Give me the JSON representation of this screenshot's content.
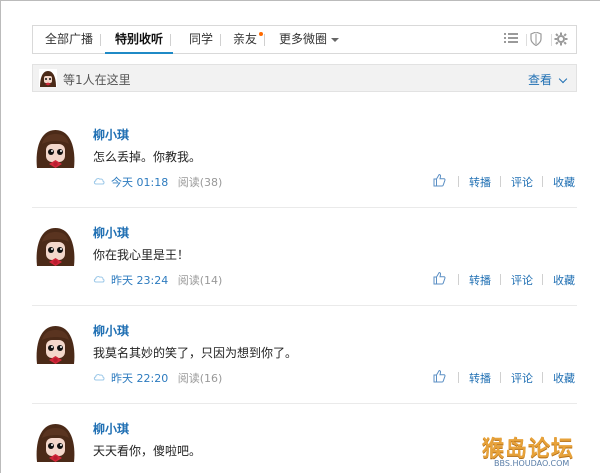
{
  "tabs": [
    {
      "label": "全部广播"
    },
    {
      "label": "特别收听"
    },
    {
      "label": "同学"
    },
    {
      "label": "亲友"
    },
    {
      "label": "更多微圈"
    }
  ],
  "herebar": {
    "text": "等1人在这里",
    "view": "查看"
  },
  "feed": {
    "items": [
      {
        "name": "柳小琪",
        "text": "怎么丢掉。你教我。",
        "time": "今天 01:18",
        "reads": "阅读(38)"
      },
      {
        "name": "柳小琪",
        "text": "你在我心里是王！",
        "time": "昨天 23:24",
        "reads": "阅读(14)"
      },
      {
        "name": "柳小琪",
        "text": "我莫名其妙的笑了，只因为想到你了。",
        "time": "昨天 22:20",
        "reads": "阅读(16)"
      },
      {
        "name": "柳小琪",
        "text": "天天看你，傻啦吧。",
        "time": "",
        "reads": ""
      }
    ],
    "actions": {
      "repost": "转播",
      "comment": "评论",
      "fav": "收藏"
    }
  },
  "watermark": {
    "big": "猴岛论坛",
    "small": "BBS.HOUDAO.COM"
  },
  "icons": {
    "list": "list-icon",
    "shield": "shield-icon",
    "gear": "gear-icon",
    "like": "like-icon",
    "cloud": "cloud-icon"
  },
  "colors": {
    "accent": "#1f8ac6",
    "link": "#1f6fb3",
    "dot": "#ff6a00"
  }
}
